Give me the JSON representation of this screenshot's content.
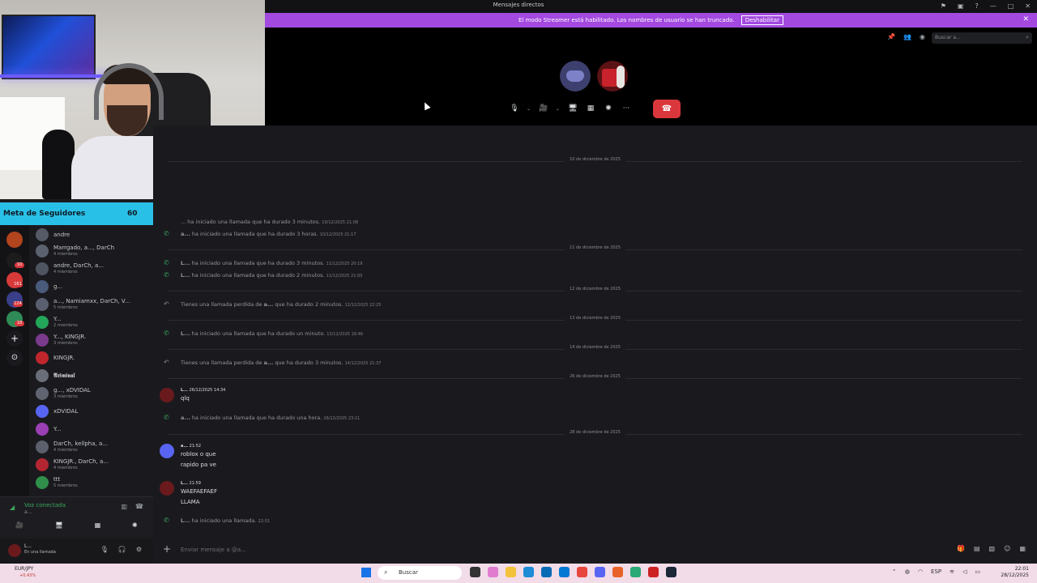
{
  "window": {
    "title": "Mensajes directos",
    "icons": [
      "flag-icon",
      "screen-icon",
      "help-icon",
      "minimize-icon",
      "maximize-icon",
      "close-icon"
    ]
  },
  "streamer_banner": {
    "text": "El modo Streamer está habilitado. Los nombres de usuario se han truncado.",
    "button": "Deshabilitar",
    "close": "✕",
    "color": "#a349e0"
  },
  "call_header": {
    "search_placeholder": "Buscar a..."
  },
  "call_controls": {
    "mic": "🎙",
    "camera": "🎥",
    "screen": "🖥",
    "activities": "▦",
    "soundboard": "✺",
    "more": "···",
    "hangup": "☎",
    "hangup_color": "#da373c"
  },
  "goal": {
    "label": "Meta de Seguidores",
    "current": "60",
    "max": "100",
    "progress": 0.6,
    "fill_color": "#29c0e8"
  },
  "server_badges": [
    "10",
    "161",
    "124",
    "18"
  ],
  "dms": [
    {
      "name": "andre",
      "sub": ""
    },
    {
      "name": "Marrgado, a..., DarCh",
      "sub": "4 miembros"
    },
    {
      "name": "andre, DarCh, a...",
      "sub": "4 miembros"
    },
    {
      "name": "g...",
      "sub": ""
    },
    {
      "name": "a..., Namiamxx, DarCh, V...",
      "sub": "5 miembros"
    },
    {
      "name": "Y...",
      "sub": "2 miembros"
    },
    {
      "name": "Y..., KINGJR.",
      "sub": "3 miembros"
    },
    {
      "name": "KINGJR.",
      "sub": ""
    },
    {
      "name": "𝕬𝖗𝖎𝖒𝖎𝖓𝖆𝖑",
      "sub": ""
    },
    {
      "name": "g..., xDVIDAL",
      "sub": "3 miembros"
    },
    {
      "name": "xDVIDAL",
      "sub": ""
    },
    {
      "name": "Y...",
      "sub": ""
    },
    {
      "name": "DarCh, kellpha, a...",
      "sub": "4 miembros"
    },
    {
      "name": "KINGJR., DarCh, a...",
      "sub": "4 miembros"
    },
    {
      "name": "ttt",
      "sub": "5 miembros"
    }
  ],
  "voice": {
    "status": "Voz conectada",
    "sub": "a..."
  },
  "user": {
    "name": "L...",
    "status": "En una llamada"
  },
  "chat": {
    "date_1": "10 de diciembre de 2025",
    "sys_1": {
      "text": "... ha iniciado una llamada que ha durado 3 minutos.",
      "ts": "10/12/2025 21:08"
    },
    "sys_2": {
      "author": "a...",
      "text": "ha iniciado una llamada que ha durado 3 horas.",
      "ts": "10/12/2025 21:17"
    },
    "date_2": "11 de diciembre de 2025",
    "sys_3": {
      "author": "L...",
      "text": "ha iniciado una llamada que ha durado 3 minutos.",
      "ts": "11/12/2025 20:19"
    },
    "sys_4": {
      "author": "L...",
      "text": "ha iniciado una llamada que ha durado 2 minutos.",
      "ts": "11/12/2025 21:05"
    },
    "date_3": "12 de diciembre de 2025",
    "sys_5": {
      "pre": "Tienes una llamada perdida de",
      "author": "a...",
      "text": "que ha durado 2 minutos.",
      "ts": "12/12/2025 22:25"
    },
    "date_4": "13 de diciembre de 2025",
    "sys_6": {
      "author": "L...",
      "text": "ha iniciado una llamada que ha durado un minuto.",
      "ts": "13/12/2025 16:46"
    },
    "date_5": "14 de diciembre de 2025",
    "sys_7": {
      "pre": "Tienes una llamada perdida de",
      "author": "a...",
      "text": "que ha durado 3 minutos.",
      "ts": "14/12/2025 21:37"
    },
    "date_6": "26 de diciembre de 2025",
    "msg_1": {
      "author": "L...",
      "ts": "26/12/2025 14:34",
      "line1": "qlq"
    },
    "sys_8": {
      "author": "a...",
      "text": "ha iniciado una llamada que ha durado una hora.",
      "ts": "26/12/2025 23:11"
    },
    "date_7": "28 de diciembre de 2025",
    "msg_2": {
      "author": "a...",
      "ts": "21:52",
      "line1": "roblox o que",
      "line2": "rapido pa ve"
    },
    "msg_3": {
      "author": "L...",
      "ts": "21:59",
      "line1": "WAEFAEFAEF",
      "line2": "LLAMA"
    },
    "sys_9": {
      "author": "L...",
      "text": "ha iniciado una llamada.",
      "ts": "22:01"
    }
  },
  "composer": {
    "placeholder": "Enviar mensaje a @a..."
  },
  "taskbar": {
    "stock_name": "EUR/JPY",
    "stock_change": "+0,43%",
    "search": "Buscar",
    "lang": "ESP",
    "time": "22:01",
    "date": "28/12/2025"
  }
}
